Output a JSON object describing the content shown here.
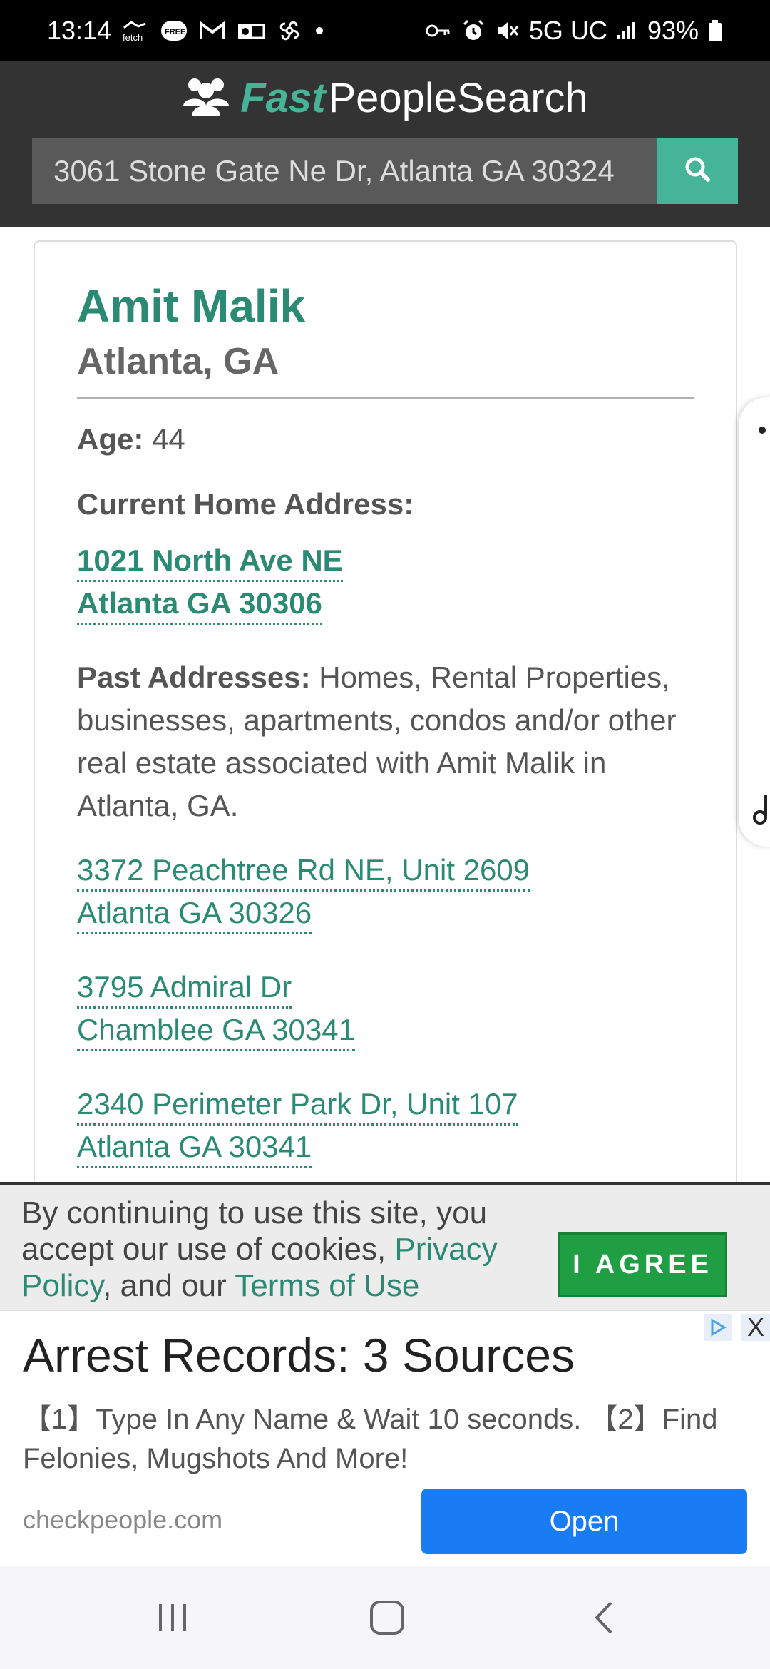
{
  "status_bar": {
    "time": "13:14",
    "app_icons": [
      "fetch-icon",
      "free-badge-icon",
      "gmail-icon",
      "outlook-icon",
      "pinwheel-icon",
      "dot-icon"
    ],
    "fetch_label": "fetch",
    "free_label": "FREE",
    "network": "5G UC",
    "battery": "93%"
  },
  "header": {
    "logo_fast": "Fast",
    "logo_rest": "PeopleSearch",
    "search_value": "3061 Stone Gate Ne Dr, Atlanta GA 30324",
    "search_icon": "search-icon",
    "brand_color": "#46b497"
  },
  "profile": {
    "name": "Amit Malik",
    "location": "Atlanta, GA",
    "age_label": "Age:",
    "age_value": "44",
    "current_label": "Current Home Address:",
    "current_address": [
      "1021 North Ave NE",
      "Atlanta GA 30306"
    ],
    "past_label": "Past Addresses:",
    "past_description": "Homes, Rental Properties, businesses, apartments, condos and/or other real estate associated with Amit Malik in Atlanta, GA.",
    "past_addresses": [
      [
        "3372 Peachtree Rd NE, Unit 2609",
        "Atlanta GA 30326"
      ],
      [
        "3795 Admiral Dr",
        "Chamblee GA 30341"
      ],
      [
        "2340 Perimeter Park Dr, Unit 107",
        "Atlanta GA 30341"
      ]
    ],
    "link_color": "#2b8a74"
  },
  "cookie_banner": {
    "text_before": "By continuing to use this site, you accept our use of cookies, ",
    "privacy_link": "Privacy Policy",
    "text_middle": ", and our ",
    "terms_link": "Terms of Use",
    "agree_label": "I AGREE"
  },
  "ad": {
    "title": "Arrest Records: 3 Sources",
    "description": "【1】Type In Any Name & Wait 10 seconds. 【2】Find Felonies, Mugshots And More!",
    "domain": "checkpeople.com",
    "open_label": "Open",
    "close_label": "X"
  },
  "nav_bar": {
    "buttons": [
      "recents-icon",
      "home-icon",
      "back-icon"
    ]
  }
}
